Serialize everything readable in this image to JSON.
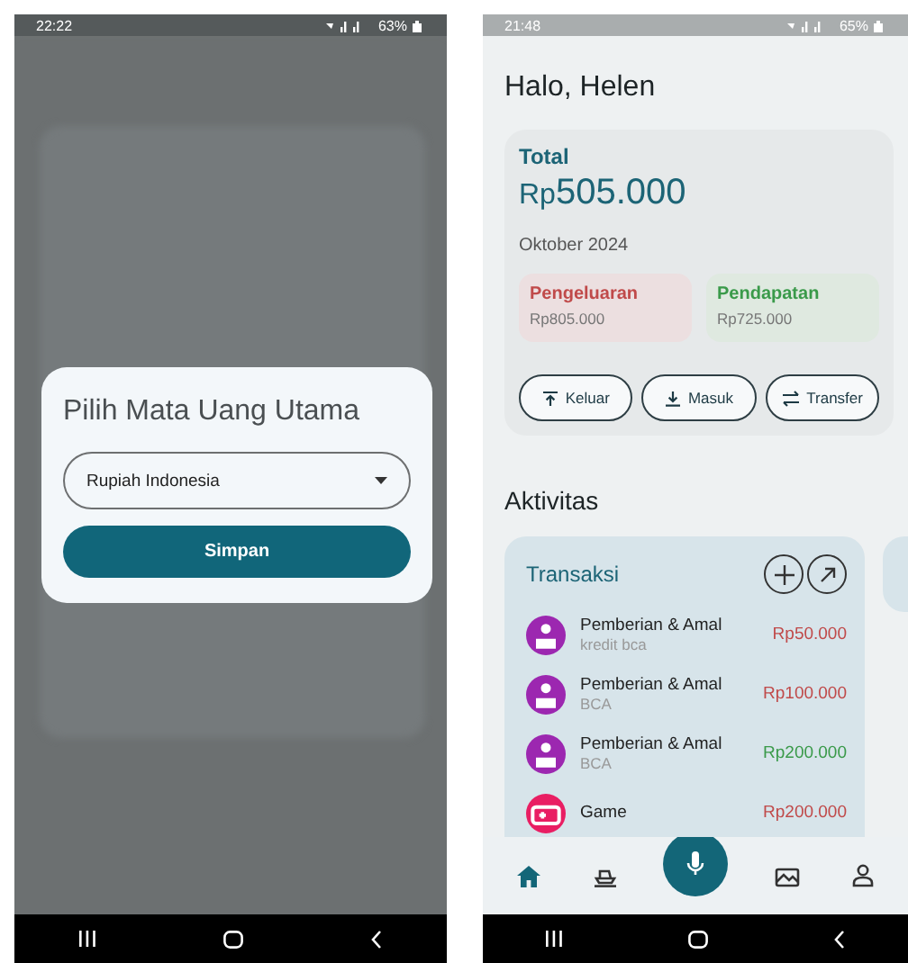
{
  "left_screen": {
    "status_bar": {
      "time": "22:22",
      "battery": "63%"
    },
    "dialog": {
      "title": "Pilih Mata Uang Utama",
      "dropdown": {
        "value": "Rupiah Indonesia"
      },
      "button": "Simpan"
    }
  },
  "right_screen": {
    "status_bar": {
      "time": "21:48",
      "battery": "65%"
    },
    "greeting": "Halo, Helen",
    "total": {
      "label": "Total",
      "currency": "Rp",
      "amount": "505.000"
    },
    "period": "Oktober 2024",
    "summary": [
      {
        "kind": "expense",
        "label": "Pengeluaran",
        "amount": "Rp805.000"
      },
      {
        "kind": "income",
        "label": "Pendapatan",
        "amount": "Rp725.000"
      }
    ],
    "actions": [
      {
        "kind": "out",
        "label": "Keluar"
      },
      {
        "kind": "in",
        "label": "Masuk"
      },
      {
        "kind": "transfer",
        "label": "Transfer"
      }
    ],
    "section_title": "Aktivitas",
    "transactions": {
      "title": "Transaksi",
      "items": [
        {
          "kind": "gift",
          "color": "#9c27b0",
          "title": "Pemberian & Amal",
          "subtitle": "kredit bca",
          "amount": "Rp50.000",
          "income": false
        },
        {
          "kind": "gift",
          "color": "#9c27b0",
          "title": "Pemberian & Amal",
          "subtitle": "BCA",
          "amount": "Rp100.000",
          "income": false
        },
        {
          "kind": "gift",
          "color": "#9c27b0",
          "title": "Pemberian & Amal",
          "subtitle": "BCA",
          "amount": "Rp200.000",
          "income": true
        },
        {
          "kind": "game",
          "color": "#e91e63",
          "title": "Game",
          "amount": "Rp200.000",
          "income": false
        }
      ]
    },
    "nav": [
      {
        "kind": "home",
        "selected": true
      },
      {
        "kind": "boat",
        "selected": false
      },
      {
        "kind": "mic",
        "selected": false
      },
      {
        "kind": "picture",
        "selected": false
      },
      {
        "kind": "person",
        "selected": false
      }
    ]
  }
}
